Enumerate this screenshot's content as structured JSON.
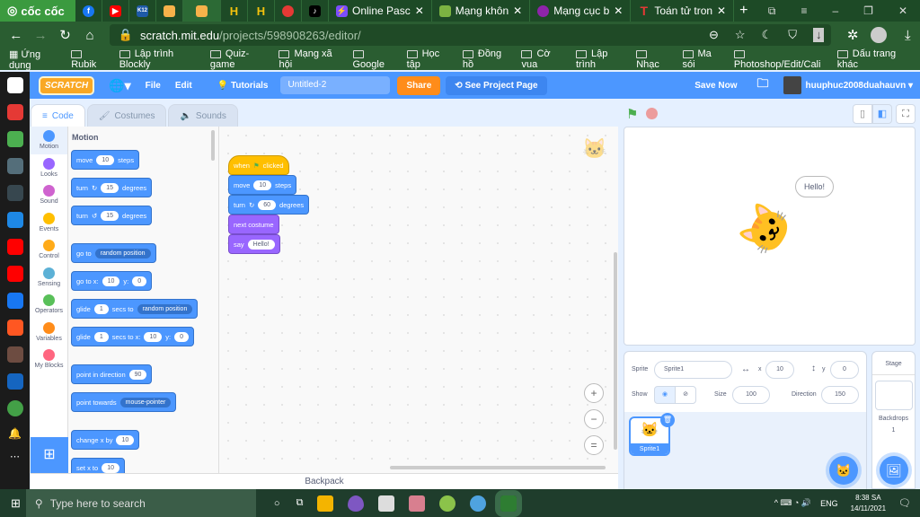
{
  "browser": {
    "brand": "cốc cốc",
    "tabs": [
      {
        "icon": "facebook-icon",
        "color": "#1877f2"
      },
      {
        "icon": "youtube-icon",
        "color": "#ff0000"
      },
      {
        "icon": "k12-icon",
        "color": "#1e5aa8",
        "label": "K12"
      },
      {
        "icon": "scratch-tab-icon",
        "color": "#f7b24a"
      },
      {
        "icon": "scratch-tab-icon",
        "color": "#f7b24a",
        "active": true
      },
      {
        "icon": "h-icon",
        "color": "#f4c20d"
      },
      {
        "icon": "h-icon",
        "color": "#f4c20d"
      },
      {
        "icon": "app-icon",
        "color": "#e53935"
      },
      {
        "icon": "tiktok-icon",
        "color": "#000000"
      }
    ],
    "named_tabs": [
      {
        "title": "Online Pasc",
        "color": "#7c4dff"
      },
      {
        "title": "Mạng khôn",
        "color": "#7cb342"
      },
      {
        "title": "Mạng cục b",
        "color": "#8e24aa"
      },
      {
        "title": "Toán tử tron",
        "color": "#e53935"
      }
    ],
    "url_host": "scratch.mit.edu",
    "url_path": "/projects/598908263/editor/",
    "bookmarks": [
      "Ứng dụng",
      "Rubik",
      "Lập trình Blockly",
      "Quiz-game",
      "Mạng xã hội",
      "Google",
      "Học tập",
      "Đồng hồ",
      "Cờ vua",
      "Lập trình",
      "Nhạc",
      "Ma sói",
      "Photoshop/Edit/Cali"
    ],
    "other_bookmarks": "Dấu trang khác"
  },
  "menu": {
    "logo": "SCRATCH",
    "file": "File",
    "edit": "Edit",
    "tutorials": "Tutorials",
    "title": "Untitled-2",
    "share": "Share",
    "see_project": "See Project Page",
    "save_now": "Save Now",
    "username": "huuphuc2008duahauvn"
  },
  "tabs": {
    "code": "Code",
    "costumes": "Costumes",
    "sounds": "Sounds"
  },
  "categories": [
    {
      "label": "Motion",
      "color": "#4c97ff"
    },
    {
      "label": "Looks",
      "color": "#9966ff"
    },
    {
      "label": "Sound",
      "color": "#cf63cf"
    },
    {
      "label": "Events",
      "color": "#ffbf00"
    },
    {
      "label": "Control",
      "color": "#ffab19"
    },
    {
      "label": "Sensing",
      "color": "#5cb1d6"
    },
    {
      "label": "Operators",
      "color": "#59c059"
    },
    {
      "label": "Variables",
      "color": "#ff8c1a"
    },
    {
      "label": "My Blocks",
      "color": "#ff6680"
    }
  ],
  "palette": {
    "heading": "Motion",
    "move": [
      "move",
      "10",
      "steps"
    ],
    "turn_right": [
      "turn",
      "15",
      "degrees"
    ],
    "turn_left": [
      "turn",
      "15",
      "degrees"
    ],
    "goto": [
      "go to",
      "random position"
    ],
    "gotoxy": [
      "go to x:",
      "10",
      "y:",
      "0"
    ],
    "glide1": [
      "glide",
      "1",
      "secs to",
      "random position"
    ],
    "glide2": [
      "glide",
      "1",
      "secs to x:",
      "10",
      "y:",
      "0"
    ],
    "point_dir": [
      "point in direction",
      "90"
    ],
    "point_towards": [
      "point towards",
      "mouse-pointer"
    ],
    "change_x": [
      "change x by",
      "10"
    ],
    "set_x": [
      "set x to",
      "10"
    ]
  },
  "script": {
    "when": "when",
    "clicked": "clicked",
    "move": [
      "move",
      "10",
      "steps"
    ],
    "turn": [
      "turn",
      "60",
      "degrees"
    ],
    "next_costume": "next costume",
    "say": [
      "say",
      "Hello!"
    ]
  },
  "backpack": "Backpack",
  "stage": {
    "speech": "Hello!"
  },
  "sprite_info": {
    "sprite_label": "Sprite",
    "sprite_name": "Sprite1",
    "x_label": "x",
    "x": "10",
    "y_label": "y",
    "y": "0",
    "show_label": "Show",
    "size_label": "Size",
    "size": "100",
    "direction_label": "Direction",
    "direction": "150",
    "thumb_name": "Sprite1"
  },
  "stage_pane": {
    "title": "Stage",
    "backdrops_label": "Backdrops",
    "backdrops": "1"
  },
  "taskbar": {
    "search_placeholder": "Type here to search",
    "lang": "ENG",
    "time": "8:38 SA",
    "date": "14/11/2021"
  }
}
